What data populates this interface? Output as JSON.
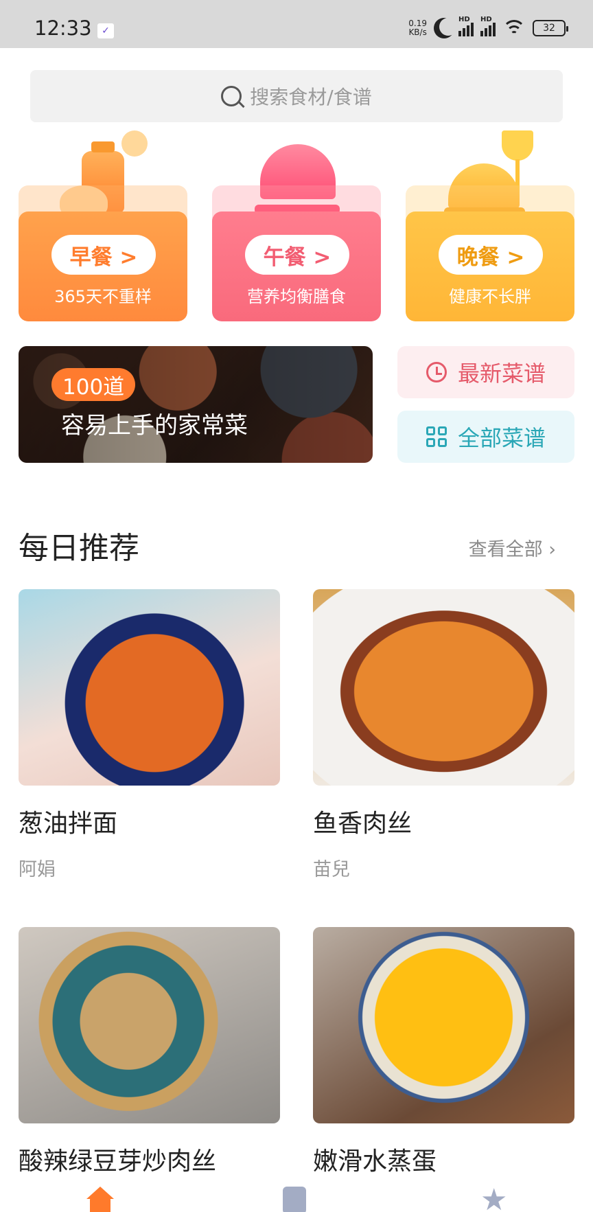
{
  "status_bar": {
    "time": "12:33",
    "app_icon": "✓",
    "net_speed_value": "0.19",
    "net_speed_unit": "KB/s",
    "signal_label": "HD",
    "battery": "32"
  },
  "search": {
    "placeholder": "搜索食材/食谱"
  },
  "meals": [
    {
      "label": "早餐 >",
      "sub": "365天不重样"
    },
    {
      "label": "午餐 >",
      "sub": "营养均衡膳食"
    },
    {
      "label": "晚餐 >",
      "sub": "健康不长胖"
    }
  ],
  "banner": {
    "badge": "100道",
    "title": "容易上手的家常菜"
  },
  "quick_links": {
    "latest": "最新菜谱",
    "all": "全部菜谱"
  },
  "daily": {
    "title": "每日推荐",
    "more": "查看全部 ›",
    "recipes": [
      {
        "name": "葱油拌面",
        "author": "阿娟"
      },
      {
        "name": "鱼香肉丝",
        "author": "苗兒"
      },
      {
        "name": "酸辣绿豆芽炒肉丝",
        "author": ""
      },
      {
        "name": "嫩滑水蒸蛋",
        "author": ""
      }
    ]
  },
  "tabbar": {
    "icons": [
      "home-icon",
      "book-icon",
      "star-icon"
    ],
    "active_color": "#ff7a2b",
    "inactive_color": "#a3acc4"
  }
}
